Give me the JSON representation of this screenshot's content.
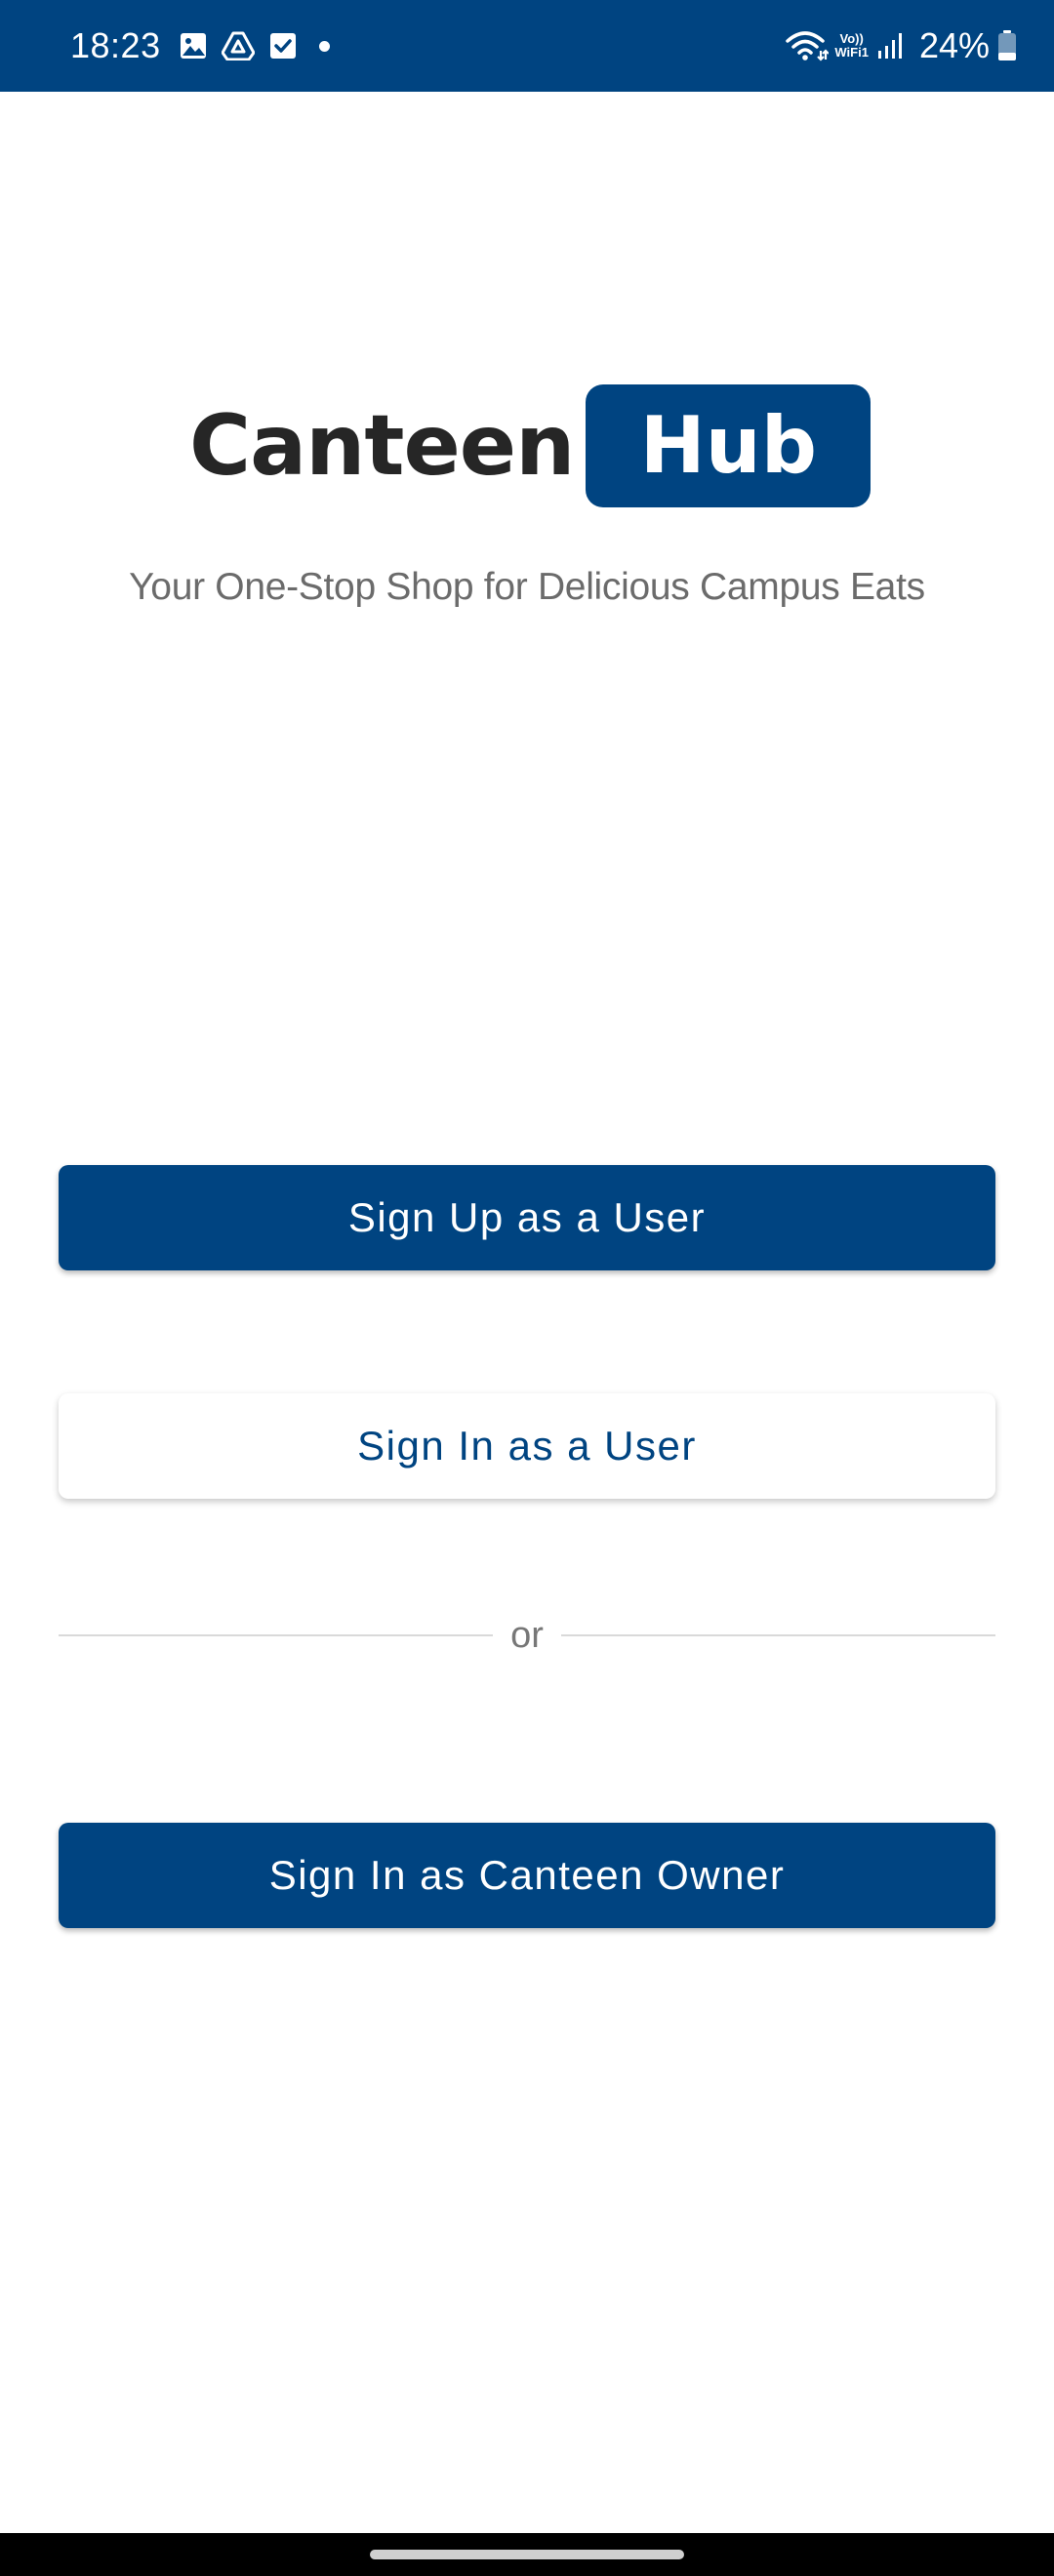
{
  "status_bar": {
    "time": "18:23",
    "notification_icons": [
      "gallery-icon",
      "drive-icon",
      "checkbox-icon"
    ],
    "volte_label_top": "Vo))",
    "volte_label_bottom": "WiFi1",
    "battery_percent": "24%",
    "battery_level": 0.24,
    "background_color": "#004481"
  },
  "logo": {
    "word_left": "Canteen",
    "word_right": "Hub",
    "brand_color": "#004481"
  },
  "tagline": "Your One-Stop Shop for Delicious Campus Eats",
  "actions": {
    "sign_up_user": "Sign Up as a User",
    "sign_in_user": "Sign In as a User",
    "divider_text": "or",
    "sign_in_owner": "Sign In as Canteen Owner"
  }
}
